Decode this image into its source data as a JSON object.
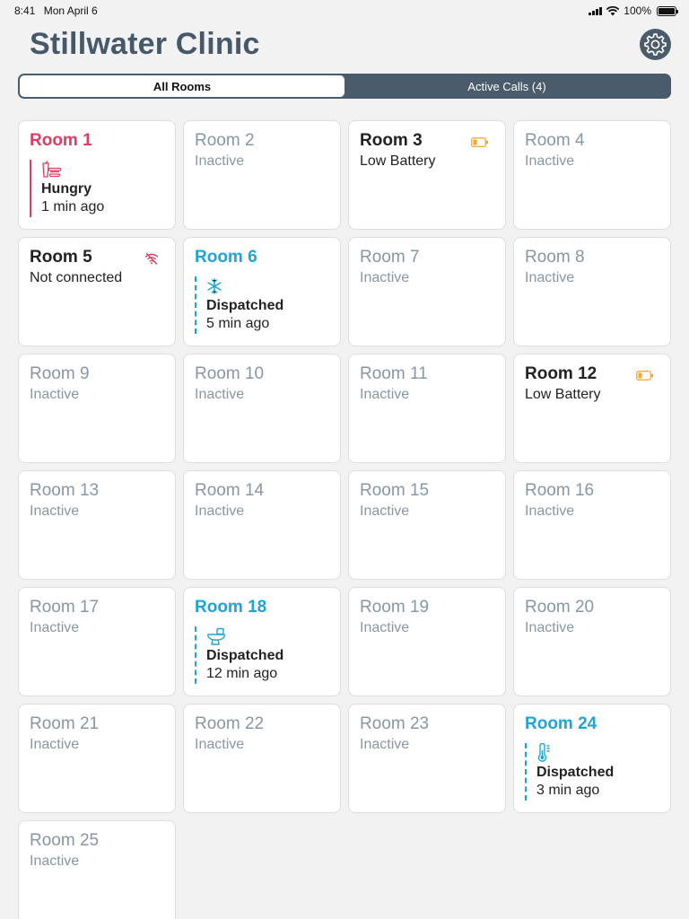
{
  "status_bar": {
    "time": "8:41",
    "date": "Mon April 6",
    "battery": "100%"
  },
  "title": "Stillwater Clinic",
  "tabs": [
    {
      "label": "All Rooms",
      "active": true
    },
    {
      "label": "Active Calls (4)",
      "active": false
    }
  ],
  "rooms": [
    {
      "name": "Room 1",
      "state": "call",
      "call_type": "hungry",
      "call_label": "Hungry",
      "time": "1 min ago",
      "icon": "food-icon"
    },
    {
      "name": "Room 2",
      "state": "inactive",
      "status": "Inactive"
    },
    {
      "name": "Room 3",
      "state": "plain",
      "status": "Low Battery",
      "icon": "low-battery-icon"
    },
    {
      "name": "Room 4",
      "state": "inactive",
      "status": "Inactive"
    },
    {
      "name": "Room 5",
      "state": "plain",
      "status": "Not connected",
      "icon": "no-wifi-icon"
    },
    {
      "name": "Room 6",
      "state": "call",
      "call_type": "dispatched",
      "call_label": "Dispatched",
      "time": "5 min ago",
      "icon": "snowflake-icon"
    },
    {
      "name": "Room 7",
      "state": "inactive",
      "status": "Inactive"
    },
    {
      "name": "Room 8",
      "state": "inactive",
      "status": "Inactive"
    },
    {
      "name": "Room 9",
      "state": "inactive",
      "status": "Inactive"
    },
    {
      "name": "Room 10",
      "state": "inactive",
      "status": "Inactive"
    },
    {
      "name": "Room 11",
      "state": "inactive",
      "status": "Inactive"
    },
    {
      "name": "Room 12",
      "state": "plain",
      "status": "Low Battery",
      "icon": "low-battery-icon"
    },
    {
      "name": "Room 13",
      "state": "inactive",
      "status": "Inactive"
    },
    {
      "name": "Room 14",
      "state": "inactive",
      "status": "Inactive"
    },
    {
      "name": "Room 15",
      "state": "inactive",
      "status": "Inactive"
    },
    {
      "name": "Room 16",
      "state": "inactive",
      "status": "Inactive"
    },
    {
      "name": "Room 17",
      "state": "inactive",
      "status": "Inactive"
    },
    {
      "name": "Room 18",
      "state": "call",
      "call_type": "dispatched",
      "call_label": "Dispatched",
      "time": "12 min ago",
      "icon": "toilet-icon"
    },
    {
      "name": "Room 19",
      "state": "inactive",
      "status": "Inactive"
    },
    {
      "name": "Room 20",
      "state": "inactive",
      "status": "Inactive"
    },
    {
      "name": "Room 21",
      "state": "inactive",
      "status": "Inactive"
    },
    {
      "name": "Room 22",
      "state": "inactive",
      "status": "Inactive"
    },
    {
      "name": "Room 23",
      "state": "inactive",
      "status": "Inactive"
    },
    {
      "name": "Room 24",
      "state": "call",
      "call_type": "dispatched",
      "call_label": "Dispatched",
      "time": "3 min ago",
      "icon": "thermometer-icon"
    },
    {
      "name": "Room 25",
      "state": "inactive",
      "status": "Inactive"
    }
  ],
  "colors": {
    "title": "#46596a",
    "segment_bg": "#4a5b6b",
    "hungry": "#e03c63",
    "dispatched": "#1ea4d6",
    "inactive": "#8797a4",
    "battery_warning": "#f5a623",
    "no_wifi": "#e03c63"
  }
}
